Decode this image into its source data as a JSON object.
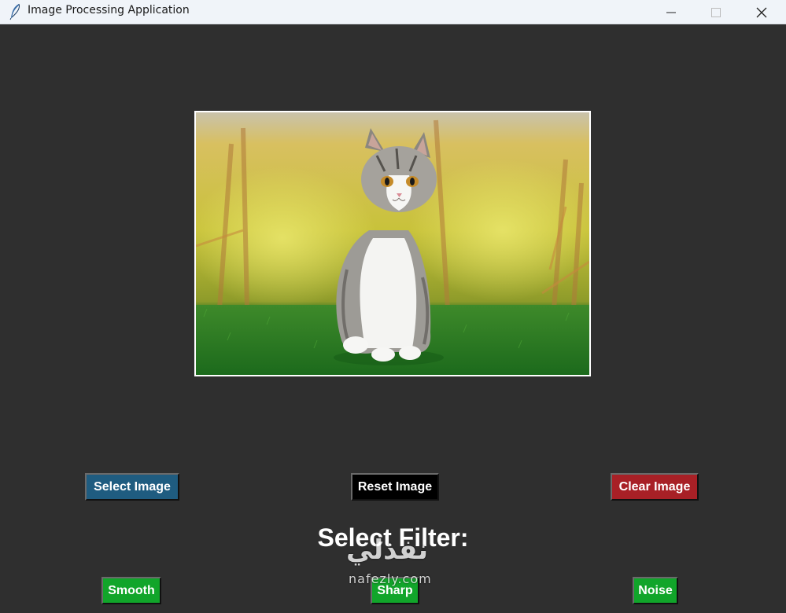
{
  "window": {
    "title": "Image Processing Application",
    "icon": "feather-icon",
    "controls": [
      "minimize-icon",
      "maximize-icon",
      "close-icon"
    ]
  },
  "image": {
    "subject": "kitten-photo"
  },
  "buttons": {
    "select_image": "Select Image",
    "reset_image": "Reset Image",
    "clear_image": "Clear Image"
  },
  "filter": {
    "label": "Select Filter:",
    "options": [
      "Smooth",
      "Sharp",
      "Noise"
    ]
  },
  "watermark": {
    "arabic": "نفذلي",
    "latin": "nafezly.com"
  },
  "colors": {
    "background": "#2f2f2f",
    "select_button": "#1f5c80",
    "reset_button": "#000000",
    "clear_button": "#a82026",
    "filter_button": "#11a52a"
  }
}
